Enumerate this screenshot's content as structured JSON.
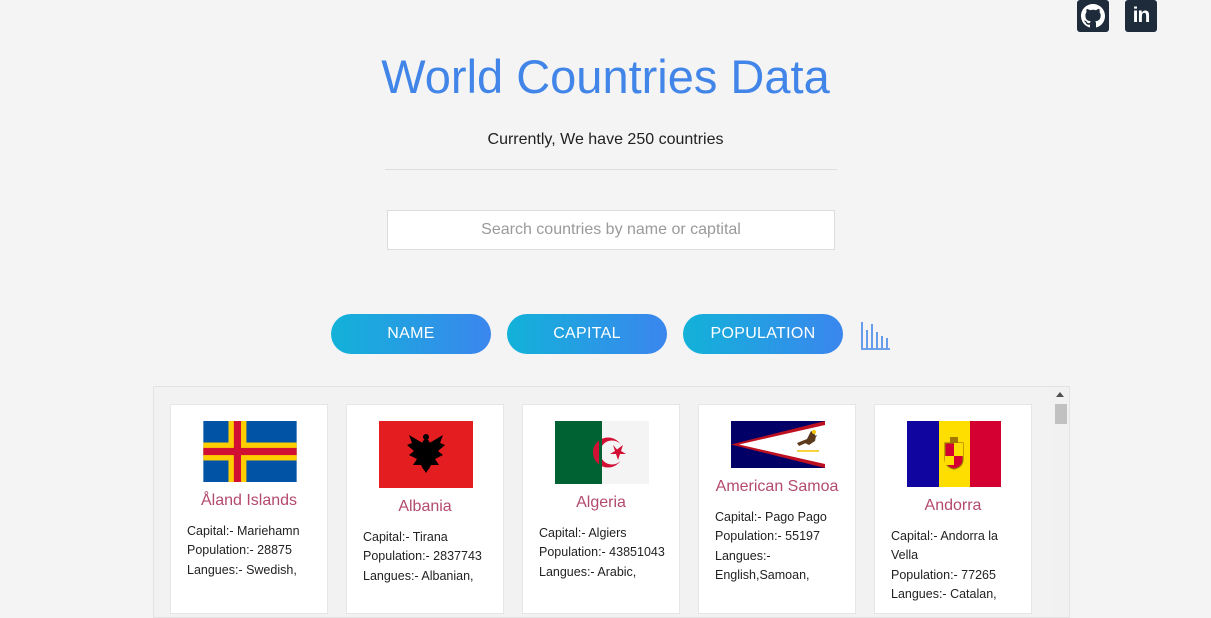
{
  "social": {
    "github_icon": "github-icon",
    "linkedin_icon": "linkedin-icon",
    "linkedin_text": "in"
  },
  "header": {
    "title": "World Countries Data",
    "subtitle": "Currently, We have 250 countries"
  },
  "search": {
    "placeholder": "Search countries by name or captital",
    "value": ""
  },
  "sort_buttons": {
    "name": "NAME",
    "capital": "CAPITAL",
    "population": "POPULATION",
    "chart_icon": "bar-chart-icon"
  },
  "colors": {
    "accent": "#4285e8",
    "country_name": "#b44a6c",
    "button_start": "#12b2d9",
    "button_end": "#3b86ee"
  },
  "countries": [
    {
      "name": "Åland Islands",
      "capital": "Capital:- Mariehamn",
      "population": "Population:- 28875",
      "languages": "Langues:- Swedish,"
    },
    {
      "name": "Albania",
      "capital": "Capital:- Tirana",
      "population": "Population:- 2837743",
      "languages": "Langues:- Albanian,"
    },
    {
      "name": "Algeria",
      "capital": "Capital:- Algiers",
      "population": "Population:- 43851043",
      "languages": "Langues:- Arabic,"
    },
    {
      "name": "American Samoa",
      "capital": "Capital:- Pago Pago",
      "population": "Population:- 55197",
      "languages": "Langues:- English,Samoan,"
    },
    {
      "name": "Andorra",
      "capital": "Capital:- Andorra la Vella",
      "population": "Population:- 77265",
      "languages": "Langues:- Catalan,"
    }
  ]
}
